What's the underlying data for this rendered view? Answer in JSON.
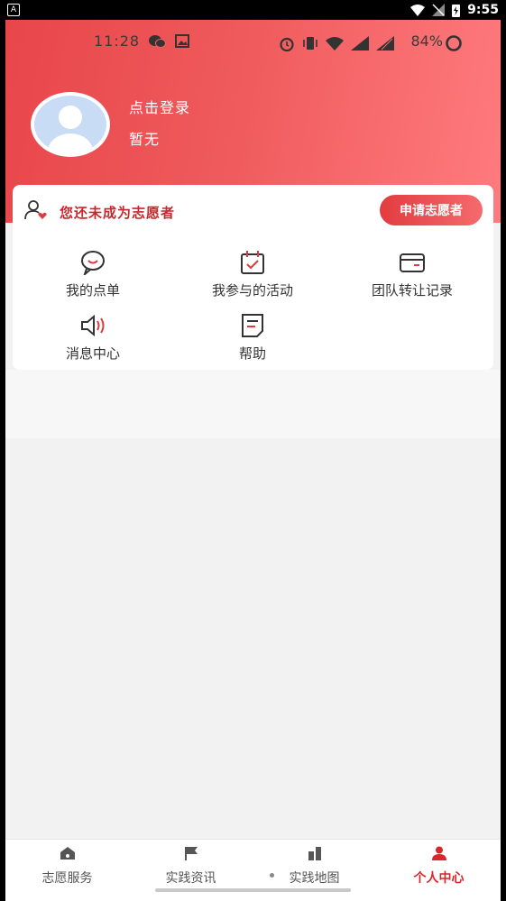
{
  "outer_status": {
    "badge": "A",
    "time": "9:55"
  },
  "inner_status": {
    "time": "11:28",
    "battery": "84%"
  },
  "profile": {
    "login_label": "点击登录",
    "sub_label": "暂无"
  },
  "volunteer": {
    "status_text": "您还未成为志愿者",
    "apply_label": "申请志愿者"
  },
  "menu": {
    "items": [
      {
        "label": "我的点单",
        "icon": "smile-chat-icon"
      },
      {
        "label": "我参与的活动",
        "icon": "calendar-check-icon"
      },
      {
        "label": "团队转让记录",
        "icon": "card-icon"
      },
      {
        "label": "消息中心",
        "icon": "speaker-icon"
      },
      {
        "label": "帮助",
        "icon": "document-icon"
      }
    ]
  },
  "tabbar": {
    "tabs": [
      {
        "label": "志愿服务",
        "icon": "home-icon"
      },
      {
        "label": "实践资讯",
        "icon": "flag-icon"
      },
      {
        "label": "实践地图",
        "icon": "buildings-icon"
      },
      {
        "label": "个人中心",
        "icon": "person-icon",
        "active": true
      }
    ]
  },
  "colors": {
    "accent": "#d9262c",
    "hero_start": "#e8464a",
    "hero_end": "#ff7b7e"
  }
}
